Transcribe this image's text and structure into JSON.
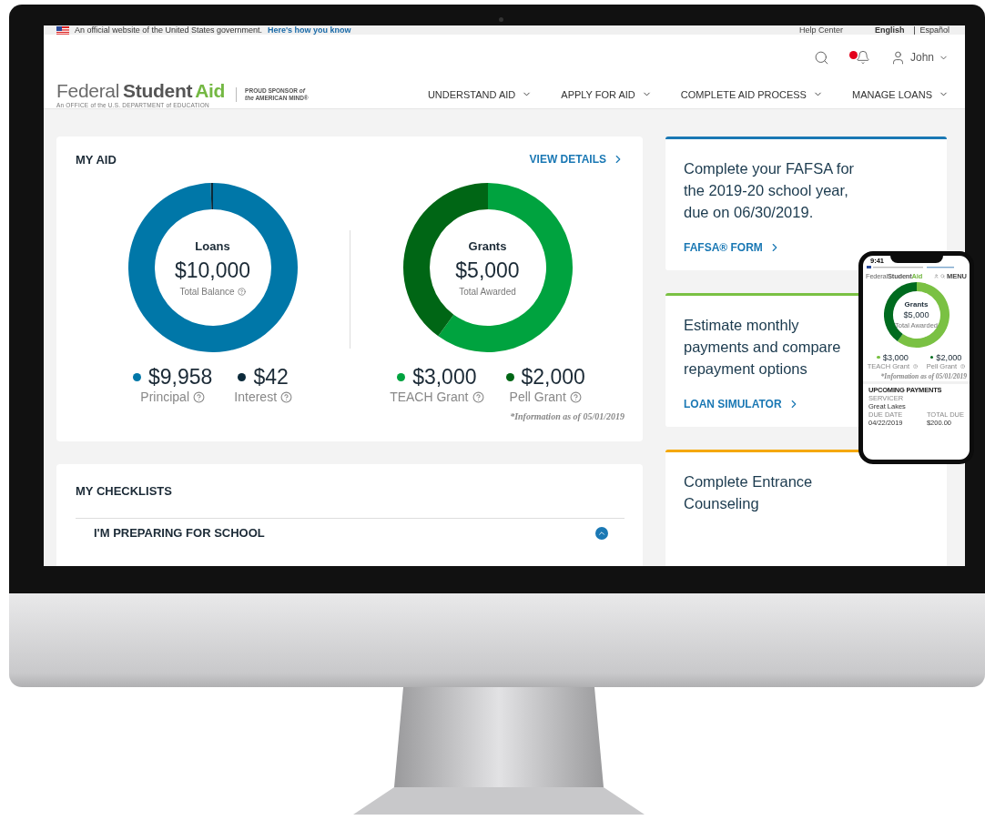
{
  "gov_banner": {
    "text": "An official website of the United States government.",
    "link": "Here's how you know",
    "help": "Help Center",
    "languages": [
      {
        "label": "English",
        "selected": true
      },
      {
        "label": "Español",
        "selected": false
      }
    ]
  },
  "header": {
    "notifications": {
      "unread": true
    },
    "user": "John",
    "logo": {
      "parts": [
        "Federal",
        "Student",
        "Aid"
      ],
      "tagline": "An OFFICE of the U.S. DEPARTMENT of EDUCATION",
      "sponsor": [
        "PROUD SPONSOR *of*",
        "*the* AMERICAN MIND®"
      ]
    },
    "nav": [
      {
        "label": "UNDERSTAND AID"
      },
      {
        "label": "APPLY FOR AID"
      },
      {
        "label": "COMPLETE AID PROCESS"
      },
      {
        "label": "MANAGE LOANS"
      }
    ]
  },
  "my_aid": {
    "title": "MY AID",
    "link": "VIEW DETAILS",
    "note": "*Information as of 05/01/2019",
    "charts": [
      {
        "title": "Loans",
        "amount": "$10,000",
        "caption": "Total Balance",
        "legend": [
          {
            "amount": "$9,958",
            "color": "#0077a8"
          },
          {
            "amount": "$42",
            "color": "#0b2a3a"
          }
        ],
        "chart_data": {
          "type": "donut",
          "categories": [
            "Principal",
            "Interest"
          ],
          "values": [
            99.58,
            0.42
          ]
        }
      },
      {
        "title": "Grants",
        "amount": "$5,000",
        "caption": "Total Awarded",
        "legend": [
          {
            "amount": "$3,000",
            "color": "#00a33f"
          },
          {
            "amount": "$2,000",
            "color": "#006615"
          }
        ],
        "chart_data": {
          "type": "donut",
          "categories": [
            "TEACH Grant",
            "Pell Grant"
          ],
          "values": [
            60,
            40
          ]
        }
      }
    ]
  },
  "checklists": {
    "title": "MY CHECKLISTS",
    "items": [
      {
        "label": "I'M PREPARING FOR SCHOOL"
      }
    ]
  },
  "promos": [
    {
      "title": "Complete your FAFSA for the 2019-20 school year, due on 06/30/2019.",
      "link": "FAFSA® FORM",
      "color": "#1a78b4"
    },
    {
      "title": "Estimate monthly payments and compare repayment options",
      "link": "LOAN SIMULATOR",
      "color": "#7ac143"
    },
    {
      "title": "Complete Entrance Counseling",
      "color": "#f5a800"
    }
  ],
  "phone": {
    "time": "9:41",
    "logo": [
      "Federal",
      "Student",
      "Aid"
    ],
    "menu": "MENU",
    "chart": {
      "title": "Grants",
      "amount": "$5,000",
      "caption": "Total Awarded",
      "legend": [
        {
          "amount": "$3,000",
          "color": "#7ac143"
        },
        {
          "amount": "$2,000",
          "color": "#006b1f"
        }
      ],
      "chart_data": {
        "type": "donut",
        "categories": [
          "TEACH Grant",
          "Pell Grant"
        ],
        "values": [
          60,
          40
        ]
      }
    },
    "note": "*Information as of 05/01/2019",
    "payments": {
      "title": "UPCOMING PAYMENTS",
      "servicer_label": "SERVICER",
      "servicer": "Great Lakes",
      "fields": [
        {
          "label": "DUE DATE",
          "value": "04/22/2019"
        },
        {
          "label": "TOTAL DUE",
          "value": "$200.00"
        }
      ]
    }
  }
}
